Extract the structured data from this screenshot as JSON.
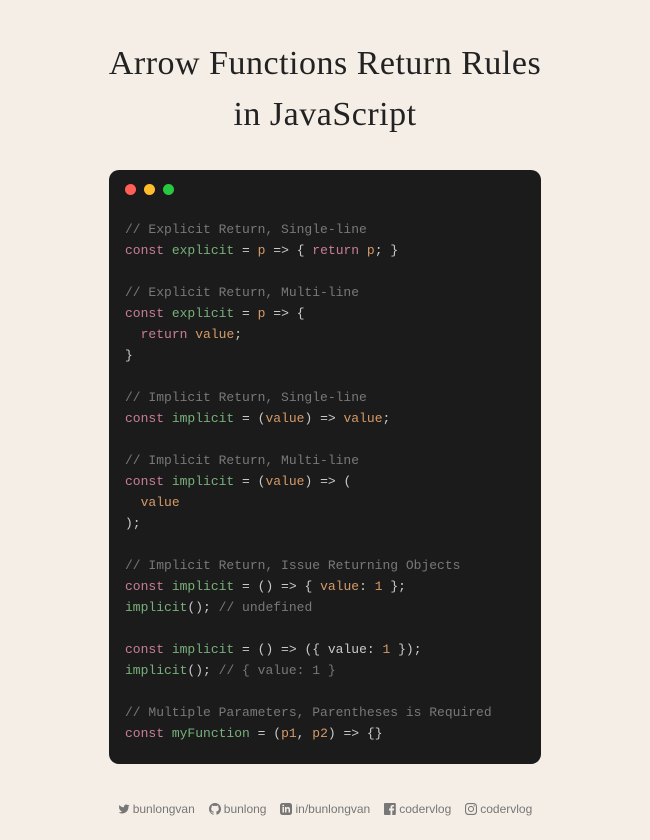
{
  "title_line1": "Arrow Functions Return Rules",
  "title_line2": "in JavaScript",
  "code": {
    "c1": "// Explicit Return, Single-line",
    "l2_const": "const",
    "l2_fn": "explicit",
    "l2_eq": " = ",
    "l2_p": "p",
    "l2_ar": " => ",
    "l2_ob": "{ ",
    "l2_ret": "return",
    "l2_sp": " ",
    "l2_p2": "p",
    "l2_end": "; }",
    "c3": "// Explicit Return, Multi-line",
    "l4_const": "const",
    "l4_fn": "explicit",
    "l4_eq": " = ",
    "l4_p": "p",
    "l4_ar": " => ",
    "l4_ob": "{",
    "l5_ind": "  ",
    "l5_ret": "return",
    "l5_sp": " ",
    "l5_val": "value",
    "l5_sc": ";",
    "l6_cb": "}",
    "c7": "// Implicit Return, Single-line",
    "l8_const": "const",
    "l8_fn": "implicit",
    "l8_eq": " = (",
    "l8_val": "value",
    "l8_cp": ") => ",
    "l8_val2": "value",
    "l8_sc": ";",
    "c9": "// Implicit Return, Multi-line",
    "l10_const": "const",
    "l10_fn": "implicit",
    "l10_eq": " = (",
    "l10_val": "value",
    "l10_cp": ") => (",
    "l11_ind": "  ",
    "l11_val": "value",
    "l12_cp": ");",
    "c13": "// Implicit Return, Issue Returning Objects",
    "l14_const": "const",
    "l14_fn": "implicit",
    "l14_eq": " = () => { ",
    "l14_val": "value",
    "l14_col": ": ",
    "l14_num": "1",
    "l14_end": " };",
    "l15_fn": "implicit",
    "l15_call": "(); ",
    "l15_cm": "// undefined",
    "l17_const": "const",
    "l17_fn": "implicit",
    "l17_eq": " = () => ({ ",
    "l17_val": "value",
    "l17_col": ": ",
    "l17_num": "1",
    "l17_end": " });",
    "l18_fn": "implicit",
    "l18_call": "(); ",
    "l18_cm": "// { value: 1 }",
    "c19": "// Multiple Parameters, Parentheses is Required",
    "l20_const": "const",
    "l20_fn": "myFunction",
    "l20_eq": " = (",
    "l20_p1": "p1",
    "l20_com": ", ",
    "l20_p2": "p2",
    "l20_end": ") => {}"
  },
  "socials": {
    "twitter": "bunlongvan",
    "github": "bunlong",
    "linkedin": "in/bunlongvan",
    "facebook": "codervlog",
    "instagram": "codervlog"
  }
}
